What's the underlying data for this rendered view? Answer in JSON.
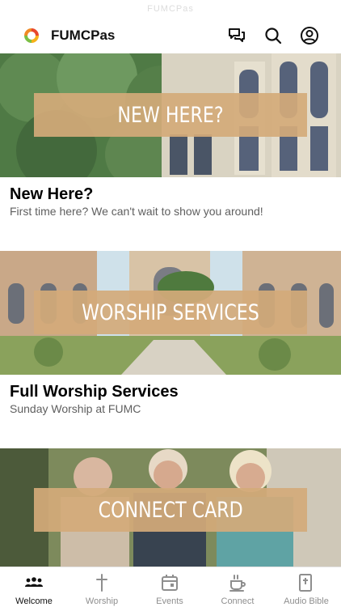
{
  "status_bar": {
    "text": "FUMCPas"
  },
  "app": {
    "title": "FUMCPas"
  },
  "header_icons": [
    "chat-bubbles-icon",
    "search-icon",
    "account-icon"
  ],
  "cards": [
    {
      "banner": "NEW HERE?",
      "title": "New Here?",
      "subtitle": "First time here? We can't wait to show you around!"
    },
    {
      "banner": "WORSHIP SERVICES",
      "title": "Full Worship Services",
      "subtitle": "Sunday Worship at FUMC"
    },
    {
      "banner": "CONNECT CARD"
    }
  ],
  "tabs": [
    {
      "label": "Welcome",
      "icon": "people-group-icon",
      "active": true
    },
    {
      "label": "Worship",
      "icon": "cross-icon",
      "active": false
    },
    {
      "label": "Events",
      "icon": "calendar-icon",
      "active": false
    },
    {
      "label": "Connect",
      "icon": "coffee-cup-icon",
      "active": false
    },
    {
      "label": "Audio Bible",
      "icon": "bible-icon",
      "active": false
    }
  ],
  "colors": {
    "banner": "#d4aa7a",
    "active_tab": "#111111",
    "inactive_tab": "#8e8e8e",
    "subtitle": "#5f5f5f"
  }
}
